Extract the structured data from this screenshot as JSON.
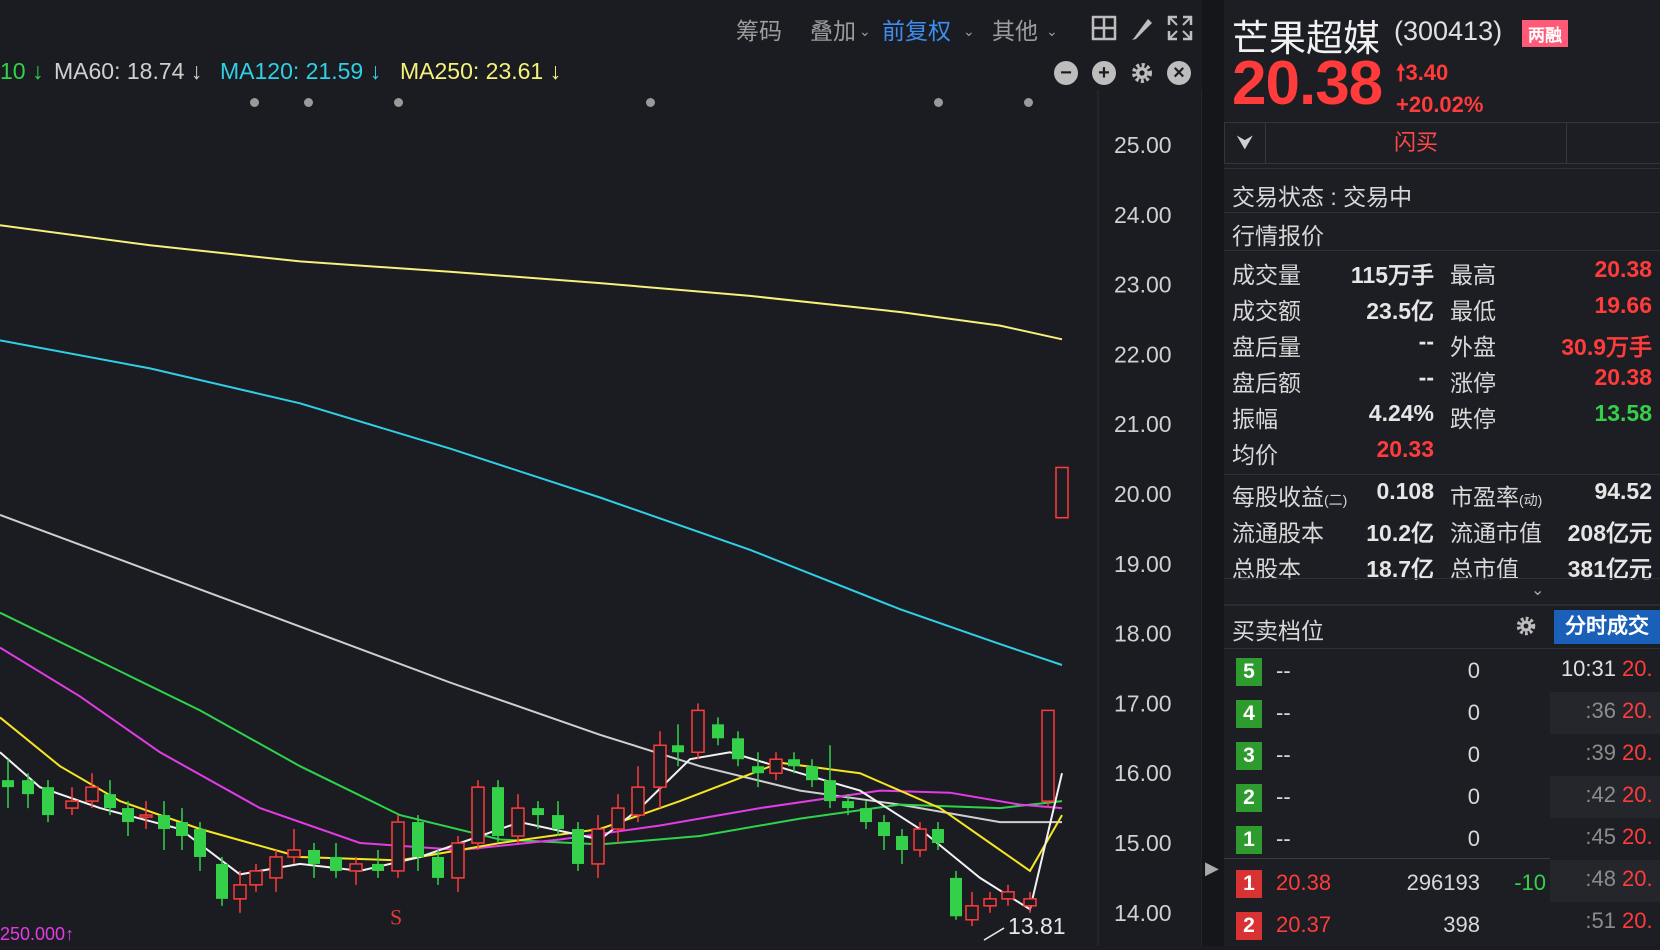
{
  "toolbar": {
    "chouma": "筹码",
    "diejia": "叠加",
    "fuquan": "前复权",
    "qita": "其他"
  },
  "ma_legend": [
    {
      "label": "10 ↓",
      "color": "#2fd34b"
    },
    {
      "label": "MA60: 18.74 ↓",
      "color": "#cfcfcf"
    },
    {
      "label": "MA120: 21.59 ↓",
      "color": "#2fd0e6"
    },
    {
      "label": "MA250: 23.61 ↓",
      "color": "#f6f17a"
    }
  ],
  "chart": {
    "price_axis": [
      "25.00",
      "24.00",
      "23.00",
      "22.00",
      "21.00",
      "20.00",
      "19.00",
      "18.00",
      "17.00",
      "16.00",
      "15.00",
      "14.00"
    ],
    "low_label": "13.81",
    "s_marker": "S",
    "bottom_fragment": "250.000↑"
  },
  "stock": {
    "name": "芒果超媒",
    "code": "(300413)",
    "badge": "两融",
    "price": "20.38",
    "change": "3.40",
    "change_pct": "+20.02%",
    "flash_buy": "闪买",
    "trade_status": "交易状态 : 交易中",
    "quote_section": "行情报价",
    "stats_left": [
      {
        "label": "成交量",
        "value": "115万手",
        "color": "#e6e6e6"
      },
      {
        "label": "成交额",
        "value": "23.5亿",
        "color": "#e6e6e6"
      },
      {
        "label": "盘后量",
        "value": "--",
        "color": "#e6e6e6"
      },
      {
        "label": "盘后额",
        "value": "--",
        "color": "#e6e6e6"
      },
      {
        "label": "振幅",
        "value": "4.24%",
        "color": "#e6e6e6"
      },
      {
        "label": "均价",
        "value": "20.33",
        "color": "#ff3b3b"
      }
    ],
    "stats_right": [
      {
        "label": "最高",
        "value": "20.38",
        "color": "#ff3b3b"
      },
      {
        "label": "最低",
        "value": "19.66",
        "color": "#ff3b3b"
      },
      {
        "label": "外盘",
        "value": "30.9万手",
        "color": "#ff3b3b"
      },
      {
        "label": "涨停",
        "value": "20.38",
        "color": "#ff3b3b"
      },
      {
        "label": "跌停",
        "value": "13.58",
        "color": "#35d04a"
      }
    ],
    "fund_left": [
      {
        "label": "每股收益",
        "sub": "(二)",
        "value": "0.108"
      },
      {
        "label": "流通股本",
        "sub": "",
        "value": "10.2亿"
      },
      {
        "label": "总股本",
        "sub": "",
        "value": "18.7亿"
      }
    ],
    "fund_right": [
      {
        "label": "市盈率",
        "sub": "(动)",
        "value": "94.52"
      },
      {
        "label": "流通市值",
        "sub": "",
        "value": "208亿元"
      },
      {
        "label": "总市值",
        "sub": "",
        "value": "381亿元"
      }
    ],
    "order_title": "买卖档位",
    "tick_title": "分时成交",
    "asks": [
      {
        "level": "5",
        "price": "--",
        "volume": "0"
      },
      {
        "level": "4",
        "price": "--",
        "volume": "0"
      },
      {
        "level": "3",
        "price": "--",
        "volume": "0"
      },
      {
        "level": "2",
        "price": "--",
        "volume": "0"
      },
      {
        "level": "1",
        "price": "--",
        "volume": "0"
      }
    ],
    "bids": [
      {
        "level": "1",
        "price": "20.38",
        "volume": "296193",
        "delta": "-10"
      },
      {
        "level": "2",
        "price": "20.37",
        "volume": "398",
        "delta": ""
      }
    ],
    "ticks": [
      {
        "time": "10:31",
        "price": "20."
      },
      {
        "time": ":36",
        "price": "20."
      },
      {
        "time": ":39",
        "price": "20."
      },
      {
        "time": ":42",
        "price": "20."
      },
      {
        "time": ":45",
        "price": "20."
      },
      {
        "time": ":48",
        "price": "20."
      },
      {
        "time": ":51",
        "price": "20."
      }
    ]
  }
}
